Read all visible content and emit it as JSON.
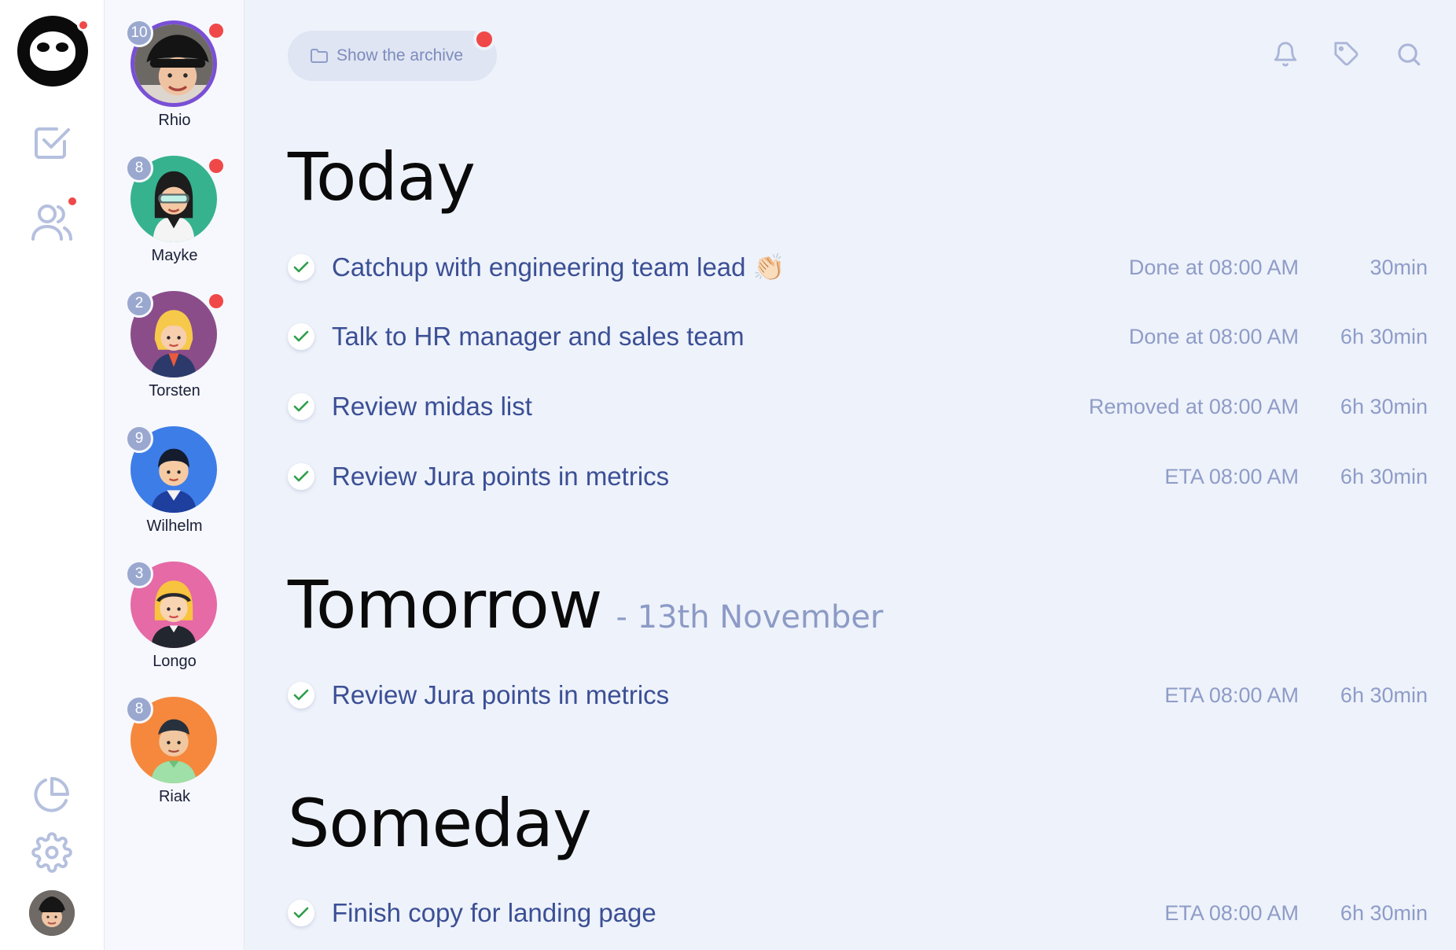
{
  "rail": {
    "colors": {
      "accent": "#f04848",
      "icon": "#b5c0de"
    }
  },
  "people": [
    {
      "name": "Rhio",
      "count": "10",
      "unread": true,
      "bg": "#2e2a28",
      "ring": "#7a4fd6",
      "kind": "photo-hat"
    },
    {
      "name": "Mayke",
      "count": "8",
      "unread": true,
      "bg": "#36b28f",
      "ring": null,
      "kind": "woman-goggles"
    },
    {
      "name": "Torsten",
      "count": "2",
      "unread": true,
      "bg": "#8a4d8a",
      "ring": null,
      "kind": "blonde-woman"
    },
    {
      "name": "Wilhelm",
      "count": "9",
      "unread": false,
      "bg": "#3d7de8",
      "ring": null,
      "kind": "boy-dark"
    },
    {
      "name": "Longo",
      "count": "3",
      "unread": false,
      "bg": "#e56aa6",
      "ring": null,
      "kind": "girl-blonde"
    },
    {
      "name": "Riak",
      "count": "8",
      "unread": false,
      "bg": "#f5883c",
      "ring": null,
      "kind": "man-green"
    }
  ],
  "toolbar": {
    "archive_label": "Show the archive"
  },
  "sections": {
    "today": {
      "title": "Today",
      "tasks": [
        {
          "title": "Catchup with engineering team lead 👏🏻",
          "status": "Done at 08:00 AM",
          "duration": "30min"
        },
        {
          "title": "Talk to HR manager and sales team",
          "status": "Done at 08:00 AM",
          "duration": "6h 30min"
        },
        {
          "title": "Review midas list",
          "status": "Removed at 08:00 AM",
          "duration": "6h 30min"
        },
        {
          "title": "Review Jura points in metrics",
          "status": "ETA 08:00 AM",
          "duration": "6h 30min"
        }
      ]
    },
    "tomorrow": {
      "title": "Tomorrow",
      "subtitle": "- 13th November",
      "tasks": [
        {
          "title": "Review Jura points in metrics",
          "status": "ETA 08:00 AM",
          "duration": "6h 30min"
        }
      ]
    },
    "someday": {
      "title": "Someday",
      "tasks": [
        {
          "title": "Finish copy for landing page",
          "status": "ETA 08:00 AM",
          "duration": "6h 30min"
        }
      ]
    }
  }
}
